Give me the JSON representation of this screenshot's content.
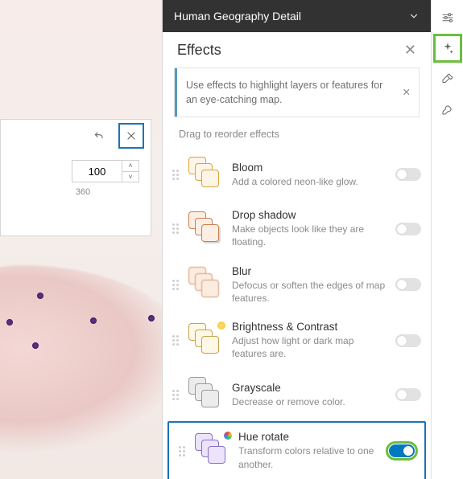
{
  "header": {
    "title": "Human Geography Detail"
  },
  "section": {
    "title": "Effects"
  },
  "info": {
    "text": "Use effects to highlight layers or features for an eye-catching map."
  },
  "drag_hint": "Drag to reorder effects",
  "effects": [
    {
      "title": "Bloom",
      "desc": "Add a colored neon-like glow.",
      "on": false
    },
    {
      "title": "Drop shadow",
      "desc": "Make objects look like they are floating.",
      "on": false
    },
    {
      "title": "Blur",
      "desc": "Defocus or soften the edges of map features.",
      "on": false
    },
    {
      "title": "Brightness & Contrast",
      "desc": "Adjust how light or dark map features are.",
      "on": false
    },
    {
      "title": "Grayscale",
      "desc": "Decrease or remove color.",
      "on": false
    },
    {
      "title": "Hue rotate",
      "desc": "Transform colors relative to one another.",
      "on": true
    }
  ],
  "hue_control": {
    "value": "100",
    "max_label": "360"
  },
  "icons": {
    "bloom_stroke": "#d9a441",
    "bloom_fill": "#fdf5e6",
    "drop_stroke": "#c77f4d",
    "drop_fill": "#fceee3",
    "blur_stroke": "#d79b73",
    "blur_fill": "#fbece0",
    "bc_stroke": "#c7a24a",
    "bc_fill": "#fff8e6",
    "gs_stroke": "#9a9a9a",
    "gs_fill": "#ececec",
    "hue_stroke": "#8a6ec9",
    "hue_fill": "#ece4fb"
  }
}
